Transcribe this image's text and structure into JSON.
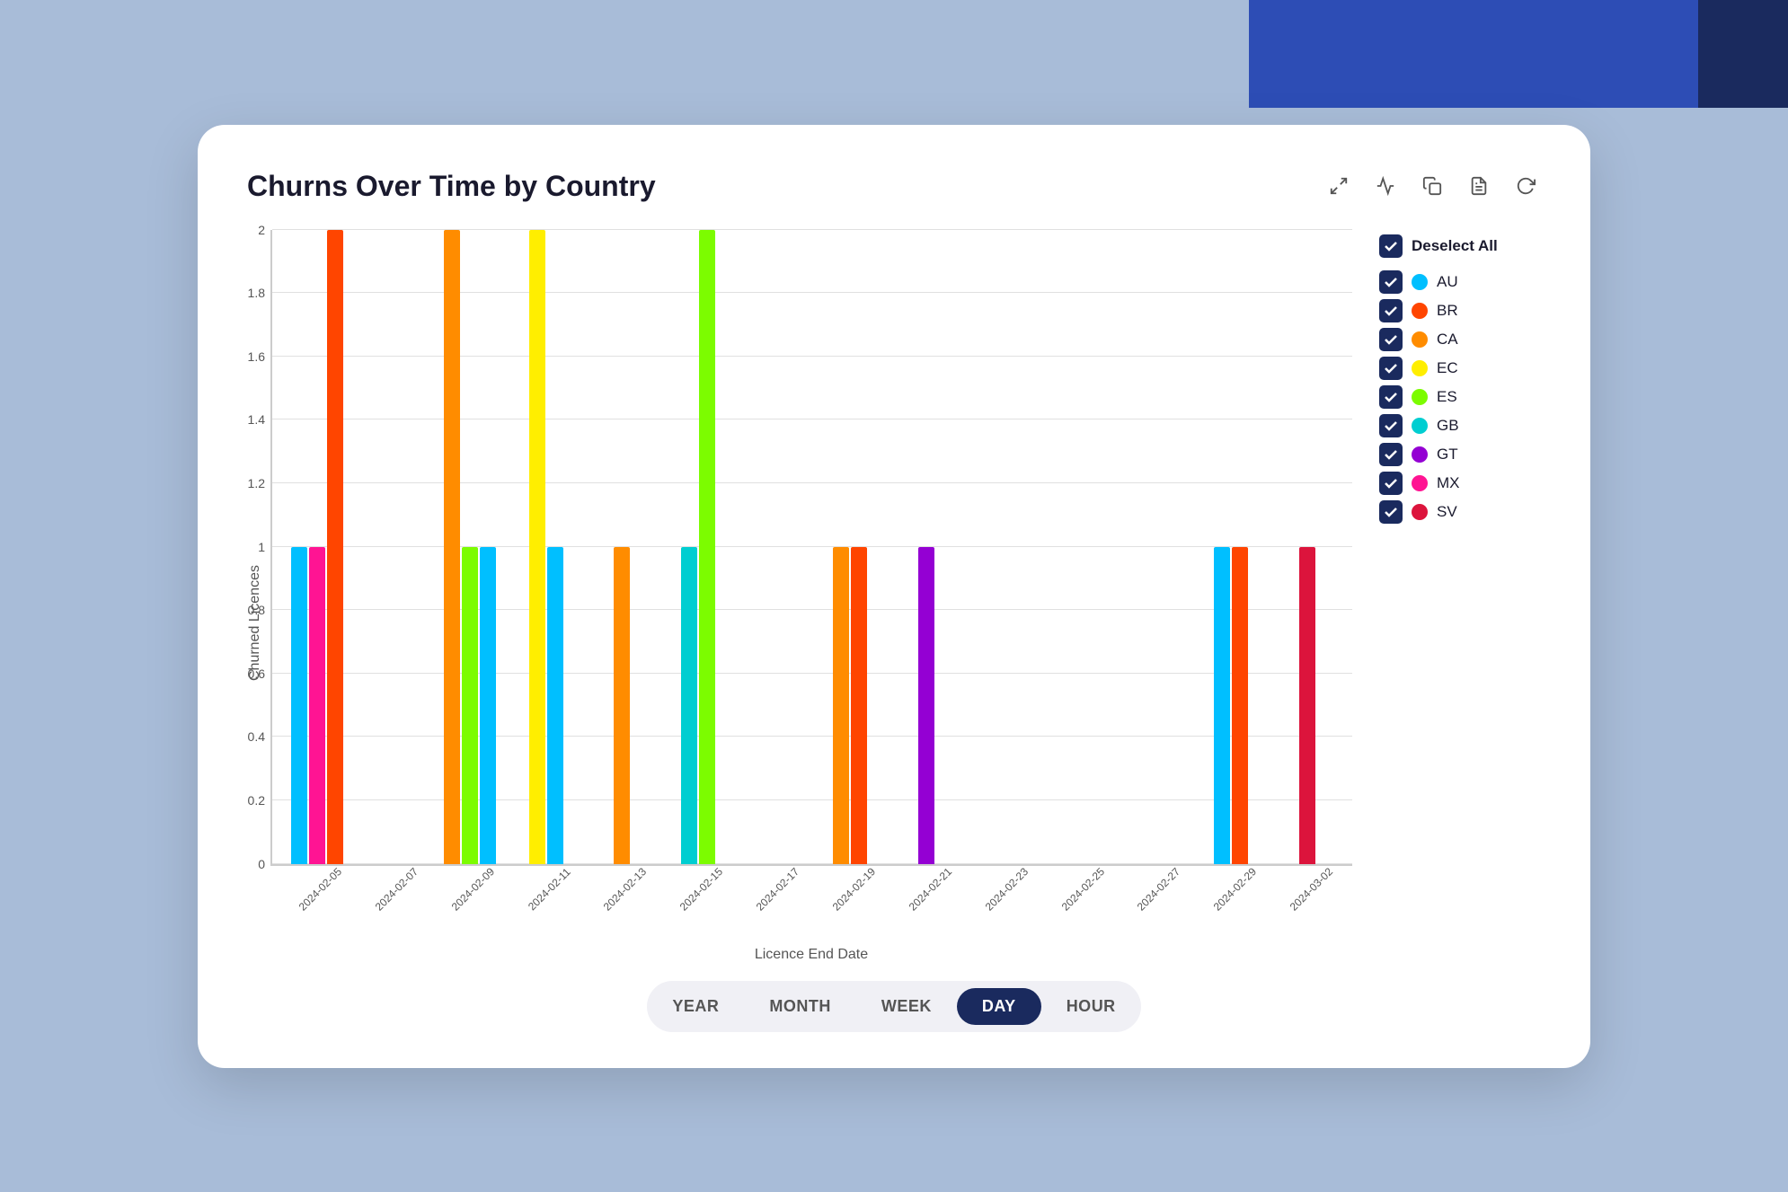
{
  "card": {
    "title": "Churns Over Time by Country",
    "yAxisLabel": "Churned Licences",
    "xAxisLabel": "Licence End Date"
  },
  "toolbar": {
    "expand_icon": "⤢",
    "chart_icon": "📈",
    "copy_icon": "📋",
    "save_icon": "💾",
    "refresh_icon": "↺"
  },
  "legend": {
    "deselect_label": "Deselect All",
    "items": [
      {
        "code": "AU",
        "color": "#00bfff"
      },
      {
        "code": "BR",
        "color": "#ff4500"
      },
      {
        "code": "CA",
        "color": "#ff8c00"
      },
      {
        "code": "EC",
        "color": "#ffee00"
      },
      {
        "code": "ES",
        "color": "#7cfc00"
      },
      {
        "code": "GB",
        "color": "#00ced1"
      },
      {
        "code": "GT",
        "color": "#9400d3"
      },
      {
        "code": "MX",
        "color": "#ff1493"
      },
      {
        "code": "SV",
        "color": "#dc143c"
      }
    ]
  },
  "yAxis": {
    "ticks": [
      "0",
      "0.2",
      "0.4",
      "0.6",
      "0.8",
      "1",
      "1.2",
      "1.4",
      "1.6",
      "1.8",
      "2"
    ]
  },
  "xAxis": {
    "dates": [
      "2024-02-05",
      "2024-02-07",
      "2024-02-09",
      "2024-02-11",
      "2024-02-13",
      "2024-02-15",
      "2024-02-17",
      "2024-02-19",
      "2024-02-21",
      "2024-02-23",
      "2024-02-25",
      "2024-02-27",
      "2024-02-29",
      "2024-03-02"
    ]
  },
  "bars": {
    "groups": [
      {
        "date": "2024-02-05",
        "bars": [
          {
            "country": "AU",
            "value": 1,
            "color": "#00bfff"
          },
          {
            "country": "MX",
            "value": 1,
            "color": "#ff1493"
          },
          {
            "country": "BR",
            "value": 2,
            "color": "#ff4500"
          }
        ]
      },
      {
        "date": "2024-02-07",
        "bars": []
      },
      {
        "date": "2024-02-09",
        "bars": [
          {
            "country": "CA",
            "value": 2,
            "color": "#ff8c00"
          },
          {
            "country": "ES",
            "value": 1,
            "color": "#7cfc00"
          },
          {
            "country": "AU",
            "value": 1,
            "color": "#00bfff"
          }
        ]
      },
      {
        "date": "2024-02-11",
        "bars": [
          {
            "country": "EC",
            "value": 2,
            "color": "#ffee00"
          },
          {
            "country": "AU",
            "value": 1,
            "color": "#00bfff"
          }
        ]
      },
      {
        "date": "2024-02-13",
        "bars": [
          {
            "country": "CA",
            "value": 1,
            "color": "#ff8c00"
          }
        ]
      },
      {
        "date": "2024-02-15",
        "bars": [
          {
            "country": "GB",
            "value": 1,
            "color": "#00ced1"
          },
          {
            "country": "ES",
            "value": 2,
            "color": "#7cfc00"
          }
        ]
      },
      {
        "date": "2024-02-17",
        "bars": []
      },
      {
        "date": "2024-02-19",
        "bars": [
          {
            "country": "CA",
            "value": 1,
            "color": "#ff8c00"
          },
          {
            "country": "BR",
            "value": 1,
            "color": "#ff4500"
          }
        ]
      },
      {
        "date": "2024-02-21",
        "bars": [
          {
            "country": "GT",
            "value": 1,
            "color": "#9400d3"
          }
        ]
      },
      {
        "date": "2024-02-23",
        "bars": []
      },
      {
        "date": "2024-02-25",
        "bars": []
      },
      {
        "date": "2024-02-27",
        "bars": []
      },
      {
        "date": "2024-02-29",
        "bars": [
          {
            "country": "AU",
            "value": 1,
            "color": "#00bfff"
          },
          {
            "country": "BR",
            "value": 1,
            "color": "#ff4500"
          }
        ]
      },
      {
        "date": "2024-03-02",
        "bars": [
          {
            "country": "SV",
            "value": 1,
            "color": "#dc143c"
          }
        ]
      }
    ]
  },
  "timePeriods": [
    {
      "label": "YEAR",
      "active": false
    },
    {
      "label": "MONTH",
      "active": false
    },
    {
      "label": "WEEK",
      "active": false
    },
    {
      "label": "DAY",
      "active": true
    },
    {
      "label": "HOUR",
      "active": false
    }
  ]
}
